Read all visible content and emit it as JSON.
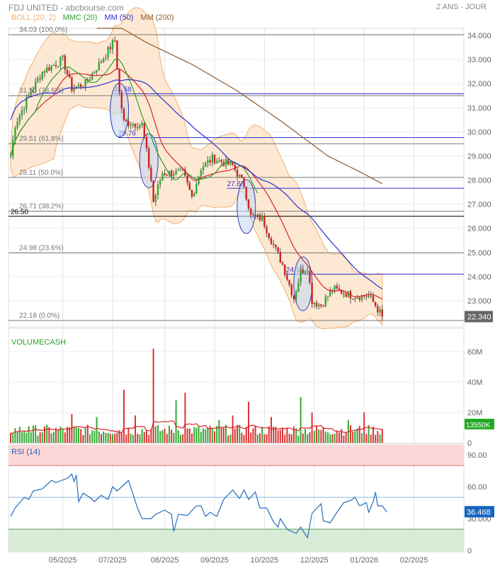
{
  "header": {
    "title": "FDJ UNITED - abcbourse.com",
    "period": "2 ANS - JOUR"
  },
  "legend": [
    {
      "label": "BOLL (20, 2)",
      "color": "#f0b070"
    },
    {
      "label": "MMC (20)",
      "color": "#2e9e2e"
    },
    {
      "label": "MM (50)",
      "color": "#3030d0"
    },
    {
      "label": "MM (200)",
      "color": "#8b5a2b"
    }
  ],
  "chart_data": [
    {
      "type": "candlestick",
      "title": "FDJ UNITED",
      "ylim": [
        22.0,
        34.3
      ],
      "yticks": [
        "34.000",
        "33.000",
        "32.000",
        "31.000",
        "30.000",
        "29.000",
        "28.000",
        "27.000",
        "26.000",
        "25.000",
        "24.000",
        "23.000"
      ],
      "ytick_values": [
        34,
        33,
        32,
        31,
        30,
        29,
        28,
        27,
        26,
        25,
        24,
        23
      ],
      "xticks": [
        "05/2025",
        "07/2025",
        "08/2025",
        "09/2025",
        "10/2025",
        "12/2025",
        "01/2026",
        "02/2025"
      ],
      "xtick_days": [
        23,
        45,
        68,
        90,
        112,
        134,
        156,
        178
      ],
      "close_keypoints": [
        [
          0,
          29.0
        ],
        [
          2,
          30.3
        ],
        [
          8,
          31.5
        ],
        [
          14,
          32.5
        ],
        [
          23,
          33.0
        ],
        [
          27,
          31.8
        ],
        [
          33,
          32.0
        ],
        [
          39,
          32.8
        ],
        [
          46,
          33.8
        ],
        [
          48,
          31.6
        ],
        [
          50,
          30.4
        ],
        [
          58,
          30.3
        ],
        [
          62,
          28.0
        ],
        [
          63,
          27.1
        ],
        [
          67,
          28.3
        ],
        [
          76,
          28.3
        ],
        [
          80,
          27.3
        ],
        [
          84,
          28.5
        ],
        [
          89,
          28.9
        ],
        [
          98,
          28.6
        ],
        [
          103,
          27.8
        ],
        [
          106,
          26.5
        ],
        [
          111,
          26.4
        ],
        [
          116,
          25.3
        ],
        [
          120,
          24.5
        ],
        [
          125,
          23.1
        ],
        [
          128,
          24.2
        ],
        [
          131,
          24.4
        ],
        [
          133,
          23.0
        ],
        [
          137,
          22.8
        ],
        [
          142,
          23.5
        ],
        [
          151,
          23.2
        ],
        [
          158,
          23.2
        ],
        [
          161,
          22.8
        ],
        [
          164,
          22.34
        ]
      ],
      "mm200_keypoints": [
        [
          38,
          34.9
        ],
        [
          60,
          33.7
        ],
        [
          80,
          32.8
        ],
        [
          100,
          31.7
        ],
        [
          120,
          30.4
        ],
        [
          140,
          29.0
        ],
        [
          155,
          28.3
        ],
        [
          164,
          27.85
        ]
      ],
      "fibonacci": [
        {
          "label": "34.03  (100.0%)",
          "price": 34.03
        },
        {
          "label": "31.50  (78.6%)",
          "price": 31.5
        },
        {
          "label": "29.51  (61.8%)",
          "price": 29.51
        },
        {
          "label": "28.11  (50.0%)",
          "price": 28.11
        },
        {
          "label": "26.71  (38.2%)",
          "price": 26.71
        },
        {
          "label": "24.98  (23.6%)",
          "price": 24.98
        },
        {
          "label": "22.18  (0.0%)",
          "price": 22.18
        }
      ],
      "support": {
        "label": "26.50",
        "price": 26.5
      },
      "gaps": [
        {
          "label": "31.58",
          "price": 31.58,
          "day": 48
        },
        {
          "label": "29.76",
          "price": 29.76,
          "day": 50
        },
        {
          "label": "27.66",
          "price": 27.66,
          "day": 98
        },
        {
          "label": "24.10",
          "price": 24.1,
          "day": 124
        }
      ],
      "ellipses": [
        {
          "day": 48,
          "price": 30.9
        },
        {
          "day": 61,
          "price": 28.8
        },
        {
          "day": 104,
          "price": 26.9
        },
        {
          "day": 129,
          "price": 23.7
        }
      ],
      "last_price": "22.340",
      "last_color": "#666666"
    },
    {
      "type": "bar",
      "title": "VOLUMECASH",
      "yticks": [
        "60M",
        "40M",
        "20M",
        "0"
      ],
      "ytick_values": [
        60,
        40,
        20,
        0
      ],
      "base_volume_m": 8,
      "spikes": [
        [
          8,
          11
        ],
        [
          27,
          19
        ],
        [
          38,
          17
        ],
        [
          50,
          35
        ],
        [
          55,
          18
        ],
        [
          63,
          62
        ],
        [
          73,
          28
        ],
        [
          77,
          33
        ],
        [
          92,
          15
        ],
        [
          98,
          18
        ],
        [
          105,
          27
        ],
        [
          115,
          17
        ],
        [
          128,
          30
        ],
        [
          133,
          20
        ],
        [
          149,
          15
        ],
        [
          156,
          20
        ]
      ],
      "last_value": "13550K",
      "last_color": "#22aa22"
    },
    {
      "type": "line",
      "title": "RSI (14)",
      "ylim": [
        0,
        100
      ],
      "yticks": [
        "90.00",
        "60.00",
        "30.000",
        "0"
      ],
      "ytick_values": [
        90,
        60,
        30,
        0
      ],
      "overbought": 80,
      "oversold": 20,
      "midline": 50,
      "keypoints": [
        [
          0,
          32
        ],
        [
          2,
          40
        ],
        [
          6,
          50
        ],
        [
          8,
          48
        ],
        [
          10,
          56
        ],
        [
          14,
          58
        ],
        [
          18,
          66
        ],
        [
          20,
          64
        ],
        [
          25,
          68
        ],
        [
          27,
          72
        ],
        [
          28,
          65
        ],
        [
          29,
          71
        ],
        [
          30,
          46
        ],
        [
          32,
          54
        ],
        [
          35,
          50
        ],
        [
          37,
          46
        ],
        [
          40,
          52
        ],
        [
          43,
          48
        ],
        [
          45,
          60
        ],
        [
          47,
          56
        ],
        [
          49,
          60
        ],
        [
          52,
          66
        ],
        [
          56,
          40
        ],
        [
          58,
          30
        ],
        [
          62,
          30
        ],
        [
          64,
          34
        ],
        [
          68,
          38
        ],
        [
          71,
          34
        ],
        [
          72,
          18
        ],
        [
          74,
          34
        ],
        [
          78,
          33
        ],
        [
          82,
          42
        ],
        [
          84,
          42
        ],
        [
          86,
          32
        ],
        [
          88,
          36
        ],
        [
          91,
          32
        ],
        [
          94,
          48
        ],
        [
          98,
          57
        ],
        [
          101,
          49
        ],
        [
          103,
          57
        ],
        [
          105,
          48
        ],
        [
          108,
          55
        ],
        [
          110,
          40
        ],
        [
          113,
          40
        ],
        [
          116,
          27
        ],
        [
          118,
          22
        ],
        [
          119,
          30
        ],
        [
          122,
          20
        ],
        [
          126,
          16
        ],
        [
          128,
          22
        ],
        [
          131,
          12
        ],
        [
          133,
          35
        ],
        [
          137,
          44
        ],
        [
          138,
          28
        ],
        [
          141,
          26
        ],
        [
          144,
          36
        ],
        [
          147,
          45
        ],
        [
          150,
          47
        ],
        [
          152,
          50
        ],
        [
          154,
          42
        ],
        [
          157,
          45
        ],
        [
          158,
          36
        ],
        [
          160,
          46
        ],
        [
          161,
          55
        ],
        [
          162,
          42
        ],
        [
          164,
          42
        ],
        [
          166,
          36
        ]
      ],
      "last_value": "36.468",
      "last_color": "#1565c0"
    }
  ]
}
